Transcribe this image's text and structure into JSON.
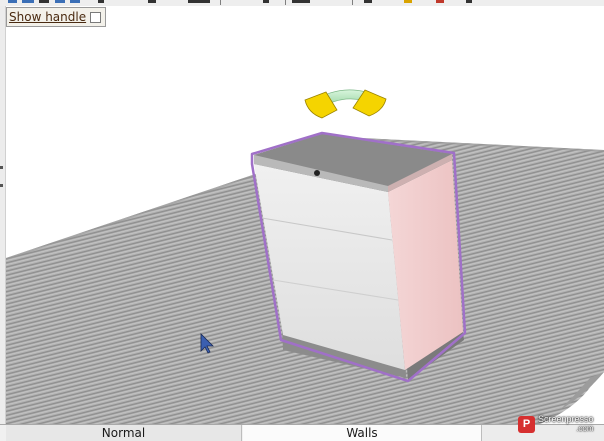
{
  "handle_control": {
    "label": "Show handle",
    "checked": false
  },
  "view_tabs": [
    {
      "label": "Normal",
      "selected": false
    },
    {
      "label": "Walls",
      "selected": true
    },
    {
      "label": "",
      "selected": false
    }
  ],
  "scene": {
    "floor_color": "#a9a9a9",
    "cabinet_front_color": "#e8e8e8",
    "cabinet_side_color": "#f2cccc",
    "cabinet_top_color": "#8f8f8f",
    "selection_outline_color": "#a070c8",
    "rotate_handle_ring_color": "#a8e0b0",
    "rotate_handle_arrow_color": "#f5d400"
  },
  "watermark": {
    "brand": "Screenpresso",
    "domain": ".com",
    "logo_letter": "P"
  },
  "colors": {
    "tab_text": "#1a1a1a",
    "handle_label": "#4a2a10"
  }
}
